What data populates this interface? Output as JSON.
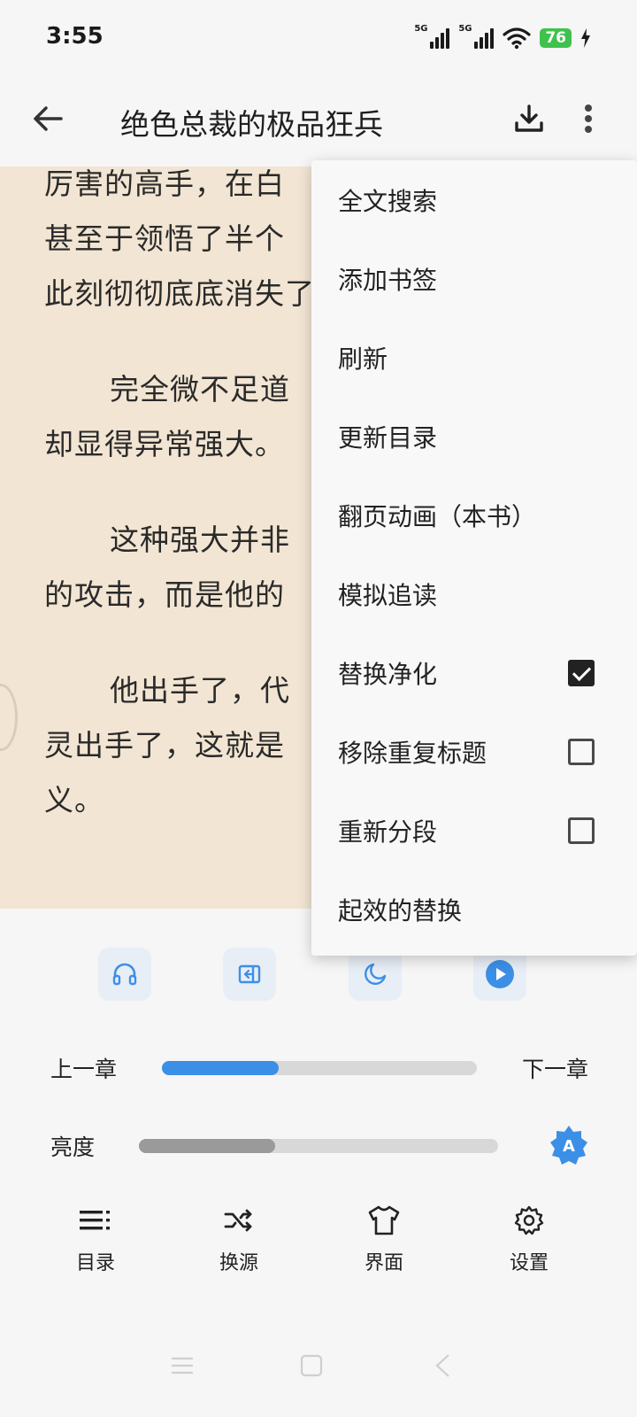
{
  "status_bar": {
    "time": "3:55",
    "signal1_label": "5G",
    "signal2_label": "5G",
    "battery": "76"
  },
  "toolbar": {
    "title": "绝色总裁的极品狂兵",
    "back_icon": "arrow-left-icon",
    "download_icon": "download-icon",
    "more_icon": "more-vert-icon"
  },
  "reader": {
    "paragraphs": [
      "厉害的高手，在白",
      "甚至于领悟了半个",
      "此刻彻彻底底消失了",
      "完全微不足道",
      "却显得异常强大。",
      "这种强大并非",
      "的攻击，而是他的",
      "他出手了，代",
      "灵出手了，这就是",
      "义。"
    ],
    "background": "#f2e5d3"
  },
  "menu": {
    "items": [
      {
        "label": "全文搜索"
      },
      {
        "label": "添加书签"
      },
      {
        "label": "刷新"
      },
      {
        "label": "更新目录"
      },
      {
        "label": "翻页动画（本书）"
      },
      {
        "label": "模拟追读"
      },
      {
        "label": "替换净化",
        "checked": true
      },
      {
        "label": "移除重复标题",
        "checked": false
      },
      {
        "label": "重新分段",
        "checked": false
      },
      {
        "label": "起效的替换"
      }
    ]
  },
  "quick_actions": [
    "headphones-icon",
    "auto-page-icon",
    "night-mode-icon",
    "play-icon"
  ],
  "chapter": {
    "prev_label": "上一章",
    "next_label": "下一章",
    "progress": 0.37
  },
  "brightness": {
    "label": "亮度",
    "level": 0.38,
    "auto_icon": "auto-brightness-icon",
    "auto_letter": "A"
  },
  "bottom_nav": [
    {
      "label": "目录",
      "icon": "toc-list-icon"
    },
    {
      "label": "换源",
      "icon": "switch-source-icon"
    },
    {
      "label": "界面",
      "icon": "shirt-theme-icon"
    },
    {
      "label": "设置",
      "icon": "gear-icon"
    }
  ],
  "colors": {
    "accent": "#3c8fe6",
    "checked": "#222222",
    "battery": "#3ec24d"
  }
}
